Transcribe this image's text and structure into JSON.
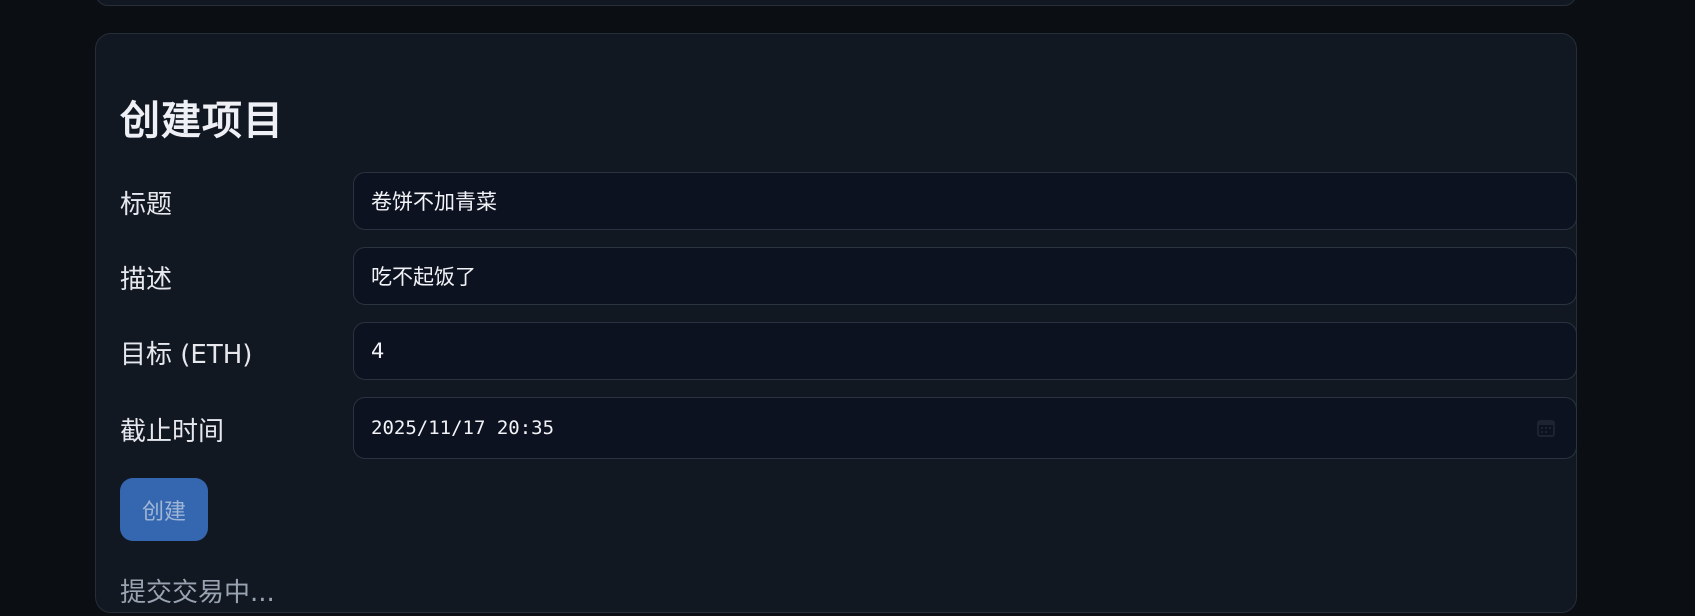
{
  "form": {
    "title": "创建项目",
    "fields": [
      {
        "label": "标题",
        "value": "卷饼不加青菜"
      },
      {
        "label": "描述",
        "value": "吃不起饭了"
      },
      {
        "label": "目标 (ETH)",
        "value": "4"
      },
      {
        "label": "截止时间",
        "value": "2025/11/17 20:35",
        "icon": "calendar-icon"
      }
    ],
    "submit_label": "创建",
    "status_text": "提交交易中..."
  },
  "colors": {
    "background": "#0b0e13",
    "card": "#121821",
    "input": "#0d1220",
    "button": "#3567b0",
    "status": "#9aa3b2"
  }
}
